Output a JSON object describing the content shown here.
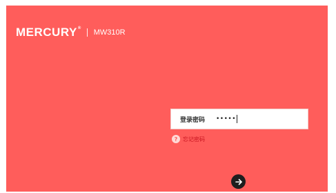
{
  "brand": {
    "logo_text": "MERCURY",
    "logo_mark": "®",
    "model": "MW310R"
  },
  "login": {
    "label": "登录密码",
    "password_masked": "•••••"
  },
  "forgot": {
    "icon": "question-icon",
    "icon_glyph": "?",
    "text": "忘记密码"
  },
  "submit": {
    "icon": "arrow-right-icon"
  },
  "colors": {
    "background": "#ff5d5b",
    "text_on_background": "#ffffff",
    "button": "#1e1e1e",
    "forgot_text": "#c8141f"
  }
}
